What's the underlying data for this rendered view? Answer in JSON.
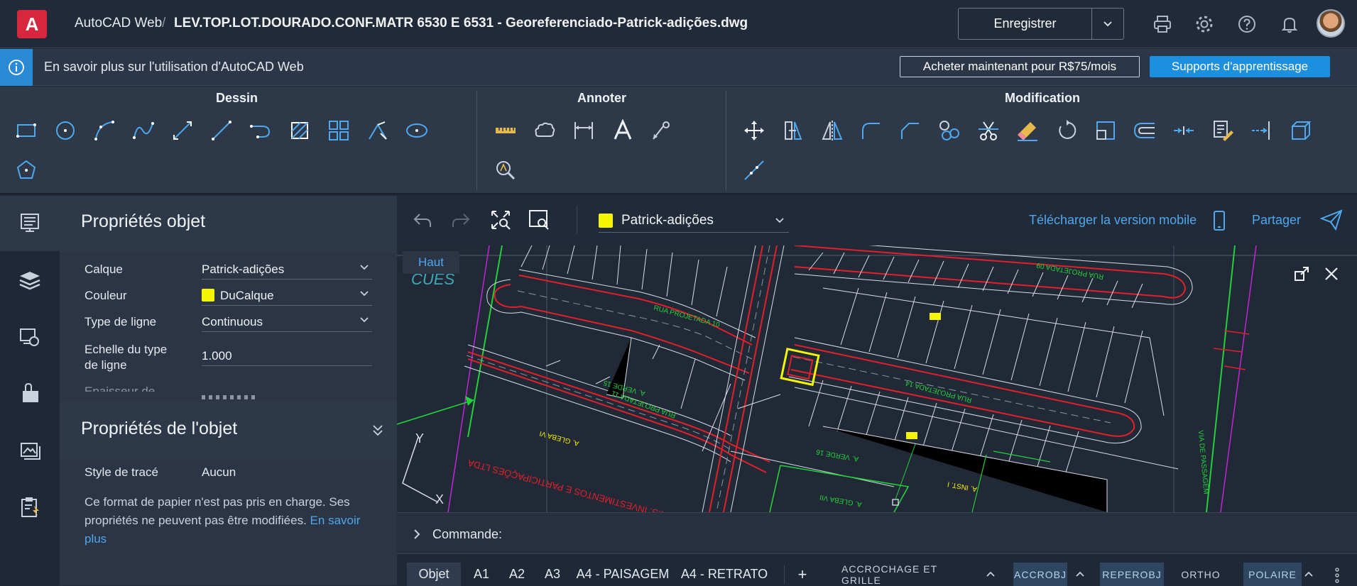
{
  "topbar": {
    "logo_letter": "A",
    "app_name": "AutoCAD Web",
    "separator": "/",
    "file_name": "LEV.TOP.LOT.DOURADO.CONF.MATR 6530 E 6531 - Georeferenciado-Patrick-adições.dwg",
    "save_label": "Enregistrer",
    "icons": [
      "print-icon",
      "gear-icon",
      "help-icon",
      "bell-icon"
    ]
  },
  "infobar": {
    "text": "En savoir plus sur l'utilisation d'AutoCAD Web",
    "buy_label": "Acheter maintenant pour R$75/mois",
    "learn_label": "Supports d'apprentissage"
  },
  "ribbon": {
    "groups": [
      {
        "title": "Dessin"
      },
      {
        "title": "Annoter"
      },
      {
        "title": "Modification"
      }
    ]
  },
  "properties": {
    "title": "Propriétés objet",
    "rows": [
      {
        "label": "Calque",
        "value": "Patrick-adições"
      },
      {
        "label": "Couleur",
        "value": "DuCalque"
      },
      {
        "label": "Type de ligne",
        "value": "Continuous"
      },
      {
        "label_line1": "Echelle du type",
        "label_line2": "de ligne",
        "value": "1.000"
      }
    ],
    "cut_label": "Epaisseur de"
  },
  "properties2": {
    "title": "Propriétés de l'objet",
    "plot_style_label": "Style de tracé",
    "plot_style_value": "Aucun",
    "note": "Ce format de papier n'est pas pris en charge. Ses propriétés ne peuvent pas être modifiées.",
    "note_link": "En savoir plus"
  },
  "canvas": {
    "layer": "Patrick-adições",
    "mobile_link": "Télécharger la version mobile",
    "share_link": "Partager",
    "view_label": "Haut",
    "ucs_x": "X",
    "ucs_y": "Y",
    "colors": {
      "layer": "#f5f500",
      "link": "#4fa7ec",
      "road": "#e0202a",
      "lot": "#d8dde6",
      "green": "#22d13a"
    },
    "drawing_text": {
      "street_1": "RUA PROJETADA 10",
      "street_2": "RUA PROJETADA 11",
      "street_3": "RUA PROJETADA 09",
      "street_4": "RUA PROJETADA 14",
      "area_1": "A. VERDE 15",
      "area_2": "A. VERDE 16",
      "area_3": "A. GLEBA VI",
      "area_4": "A. GLEBA VII",
      "area_5": "A. INST. I",
      "company": "N.S. INVESTIMENTOS E PARTICIPAÇÕES LTDA",
      "via": "VIA DE PASSAGEM"
    }
  },
  "command": {
    "label": "Commande:"
  },
  "status": {
    "tabs": [
      "Objet",
      "A1",
      "A2",
      "A3",
      "A4 - PAISAGEM",
      "A4 - RETRATO"
    ],
    "add": "+",
    "toggles": [
      {
        "label": "ACCROCHAGE ET GRILLE",
        "on": false
      },
      {
        "label": "ACCROBJ",
        "on": true
      },
      {
        "label": "REPEROBJ",
        "on": true
      },
      {
        "label": "ORTHO",
        "on": false
      },
      {
        "label": "POLAIRE",
        "on": true
      }
    ]
  }
}
